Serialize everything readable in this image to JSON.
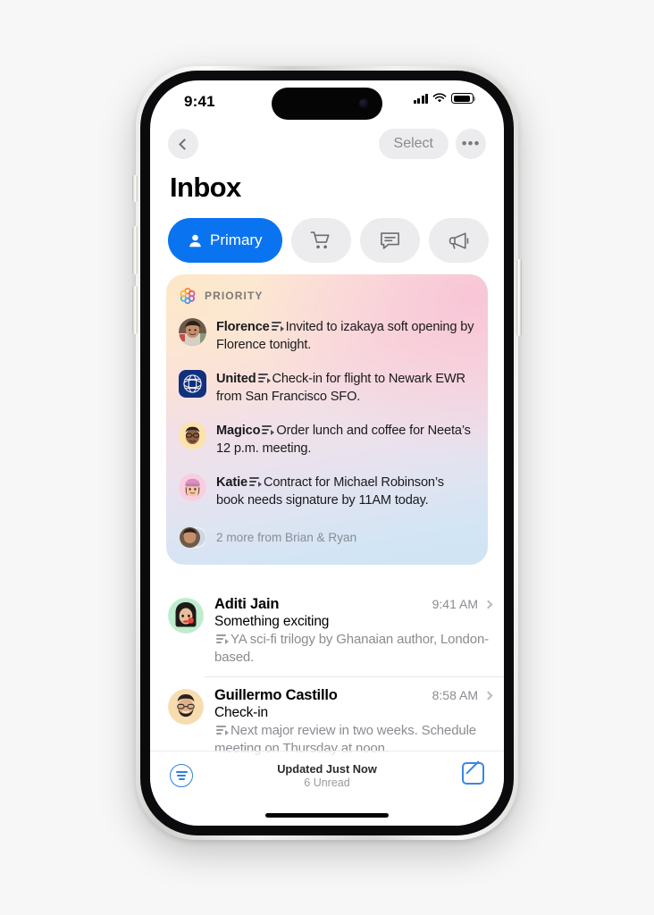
{
  "status_bar": {
    "time": "9:41",
    "signal_icon": "cellular-signal-icon",
    "wifi_icon": "wifi-icon",
    "battery_icon": "battery-full-icon"
  },
  "nav": {
    "back_icon": "chevron-left-icon",
    "select_label": "Select",
    "more_label": "•••"
  },
  "header": {
    "title": "Inbox"
  },
  "tabs": [
    {
      "id": "primary",
      "label": "Primary",
      "icon": "person-icon",
      "selected": true,
      "accent": "#0a74f0"
    },
    {
      "id": "purchases",
      "label": "",
      "icon": "cart-icon",
      "selected": false,
      "accent": "#ececee"
    },
    {
      "id": "updates",
      "label": "",
      "icon": "chat-bubble-icon",
      "selected": false,
      "accent": "#ececee"
    },
    {
      "id": "promotions",
      "label": "",
      "icon": "megaphone-icon",
      "selected": false,
      "accent": "#ececee"
    }
  ],
  "priority": {
    "header_label": "PRIORITY",
    "header_icon": "apple-intelligence-icon",
    "items": [
      {
        "sender": "Florence",
        "summary": "Invited to izakaya soft opening by Florence tonight.",
        "avatar": "photo-florence"
      },
      {
        "sender": "United",
        "summary": "Check-in for flight to Newark EWR from San Francisco SFO.",
        "avatar": "united-logo"
      },
      {
        "sender": "Magico",
        "summary": "Order lunch and coffee for Neeta’s 12 p.m. meeting.",
        "avatar": "memoji-magico"
      },
      {
        "sender": "Katie",
        "summary": "Contract for Michael Robinson’s book needs signature by 11AM today.",
        "avatar": "memoji-katie"
      }
    ],
    "more_label": "2 more from Brian & Ryan"
  },
  "messages": [
    {
      "sender": "Aditi Jain",
      "subject": "Something exciting",
      "summary": "YA sci-fi trilogy by Ghanaian author, London-based.",
      "time": "9:41 AM",
      "avatar": "memoji-aditi"
    },
    {
      "sender": "Guillermo Castillo",
      "subject": "Check-in",
      "summary": "Next major review in two weeks. Schedule meeting on Thursday at noon.",
      "time": "8:58 AM",
      "avatar": "memoji-guillermo"
    }
  ],
  "bottom_bar": {
    "filter_icon": "filter-icon",
    "status_title": "Updated Just Now",
    "status_sub": "6 Unread",
    "compose_icon": "compose-icon"
  },
  "colors": {
    "accent_blue": "#0a74f0",
    "toolbar_blue": "#3a86e6",
    "chip_gray": "#ececee",
    "secondary_text": "#8b8b92",
    "page_background": "#f7f7f7"
  }
}
